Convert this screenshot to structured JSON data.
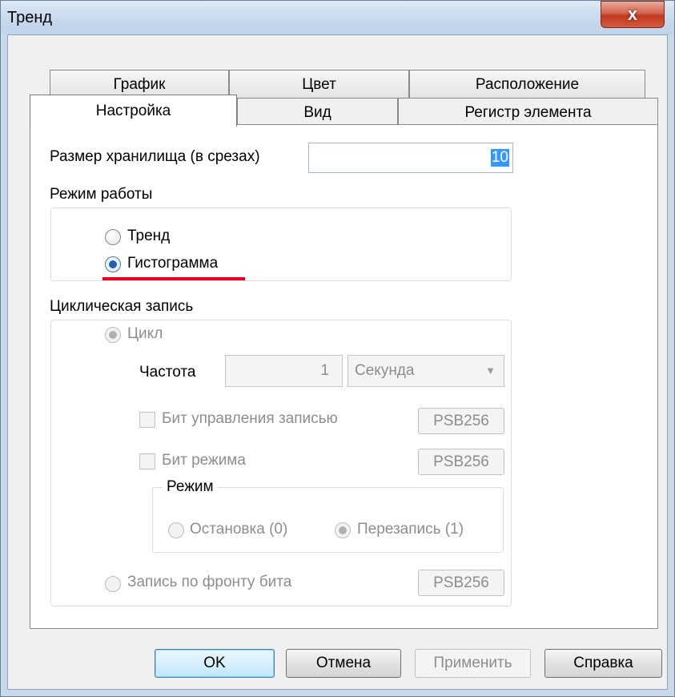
{
  "window": {
    "title": "Тренд",
    "close_glyph": "x"
  },
  "tabs": {
    "back_row": [
      "График",
      "Цвет",
      "Расположение"
    ],
    "front_row": [
      "Настройка",
      "Вид",
      "Регистр элемента"
    ],
    "active": "Настройка"
  },
  "storage": {
    "label": "Размер хранилища (в срезах)",
    "value": "10"
  },
  "mode": {
    "group_label": "Режим работы",
    "options": [
      "Тренд",
      "Гистограмма"
    ],
    "selected": "Гистограмма",
    "highlight_color": "#e8001c"
  },
  "cyclic": {
    "group_label": "Циклическая запись",
    "cycle_label": "Цикл",
    "frequency_label": "Частота",
    "frequency_value": "1",
    "unit_value": "Секунда",
    "record_bit_label": "Бит управления записью",
    "record_bit_button": "PSB256",
    "mode_bit_label": "Бит режима",
    "mode_bit_button": "PSB256",
    "sub_mode": {
      "label": "Режим",
      "options": [
        "Остановка (0)",
        "Перезапись (1)"
      ],
      "selected": "Перезапись (1)"
    },
    "edge_label": "Запись по фронту бита",
    "edge_button": "PSB256"
  },
  "buttons": {
    "ok": "OK",
    "cancel": "Отмена",
    "apply": "Применить",
    "help": "Справка"
  },
  "colors": {
    "radio_selected": "#1f5fb8",
    "accent_frame": "#c9d9ea"
  }
}
